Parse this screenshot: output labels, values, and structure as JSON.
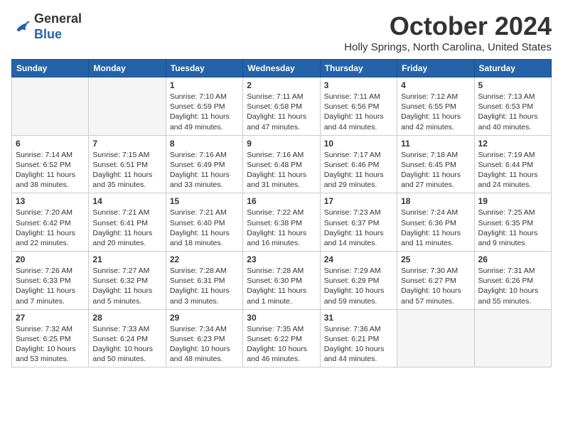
{
  "header": {
    "logo": {
      "general": "General",
      "blue": "Blue"
    },
    "title": "October 2024",
    "location": "Holly Springs, North Carolina, United States"
  },
  "days_of_week": [
    "Sunday",
    "Monday",
    "Tuesday",
    "Wednesday",
    "Thursday",
    "Friday",
    "Saturday"
  ],
  "weeks": [
    [
      {
        "day": "",
        "empty": true
      },
      {
        "day": "",
        "empty": true
      },
      {
        "day": "1",
        "sunrise": "Sunrise: 7:10 AM",
        "sunset": "Sunset: 6:59 PM",
        "daylight": "Daylight: 11 hours and 49 minutes."
      },
      {
        "day": "2",
        "sunrise": "Sunrise: 7:11 AM",
        "sunset": "Sunset: 6:58 PM",
        "daylight": "Daylight: 11 hours and 47 minutes."
      },
      {
        "day": "3",
        "sunrise": "Sunrise: 7:11 AM",
        "sunset": "Sunset: 6:56 PM",
        "daylight": "Daylight: 11 hours and 44 minutes."
      },
      {
        "day": "4",
        "sunrise": "Sunrise: 7:12 AM",
        "sunset": "Sunset: 6:55 PM",
        "daylight": "Daylight: 11 hours and 42 minutes."
      },
      {
        "day": "5",
        "sunrise": "Sunrise: 7:13 AM",
        "sunset": "Sunset: 6:53 PM",
        "daylight": "Daylight: 11 hours and 40 minutes."
      }
    ],
    [
      {
        "day": "6",
        "sunrise": "Sunrise: 7:14 AM",
        "sunset": "Sunset: 6:52 PM",
        "daylight": "Daylight: 11 hours and 38 minutes."
      },
      {
        "day": "7",
        "sunrise": "Sunrise: 7:15 AM",
        "sunset": "Sunset: 6:51 PM",
        "daylight": "Daylight: 11 hours and 35 minutes."
      },
      {
        "day": "8",
        "sunrise": "Sunrise: 7:16 AM",
        "sunset": "Sunset: 6:49 PM",
        "daylight": "Daylight: 11 hours and 33 minutes."
      },
      {
        "day": "9",
        "sunrise": "Sunrise: 7:16 AM",
        "sunset": "Sunset: 6:48 PM",
        "daylight": "Daylight: 11 hours and 31 minutes."
      },
      {
        "day": "10",
        "sunrise": "Sunrise: 7:17 AM",
        "sunset": "Sunset: 6:46 PM",
        "daylight": "Daylight: 11 hours and 29 minutes."
      },
      {
        "day": "11",
        "sunrise": "Sunrise: 7:18 AM",
        "sunset": "Sunset: 6:45 PM",
        "daylight": "Daylight: 11 hours and 27 minutes."
      },
      {
        "day": "12",
        "sunrise": "Sunrise: 7:19 AM",
        "sunset": "Sunset: 6:44 PM",
        "daylight": "Daylight: 11 hours and 24 minutes."
      }
    ],
    [
      {
        "day": "13",
        "sunrise": "Sunrise: 7:20 AM",
        "sunset": "Sunset: 6:42 PM",
        "daylight": "Daylight: 11 hours and 22 minutes."
      },
      {
        "day": "14",
        "sunrise": "Sunrise: 7:21 AM",
        "sunset": "Sunset: 6:41 PM",
        "daylight": "Daylight: 11 hours and 20 minutes."
      },
      {
        "day": "15",
        "sunrise": "Sunrise: 7:21 AM",
        "sunset": "Sunset: 6:40 PM",
        "daylight": "Daylight: 11 hours and 18 minutes."
      },
      {
        "day": "16",
        "sunrise": "Sunrise: 7:22 AM",
        "sunset": "Sunset: 6:38 PM",
        "daylight": "Daylight: 11 hours and 16 minutes."
      },
      {
        "day": "17",
        "sunrise": "Sunrise: 7:23 AM",
        "sunset": "Sunset: 6:37 PM",
        "daylight": "Daylight: 11 hours and 14 minutes."
      },
      {
        "day": "18",
        "sunrise": "Sunrise: 7:24 AM",
        "sunset": "Sunset: 6:36 PM",
        "daylight": "Daylight: 11 hours and 11 minutes."
      },
      {
        "day": "19",
        "sunrise": "Sunrise: 7:25 AM",
        "sunset": "Sunset: 6:35 PM",
        "daylight": "Daylight: 11 hours and 9 minutes."
      }
    ],
    [
      {
        "day": "20",
        "sunrise": "Sunrise: 7:26 AM",
        "sunset": "Sunset: 6:33 PM",
        "daylight": "Daylight: 11 hours and 7 minutes."
      },
      {
        "day": "21",
        "sunrise": "Sunrise: 7:27 AM",
        "sunset": "Sunset: 6:32 PM",
        "daylight": "Daylight: 11 hours and 5 minutes."
      },
      {
        "day": "22",
        "sunrise": "Sunrise: 7:28 AM",
        "sunset": "Sunset: 6:31 PM",
        "daylight": "Daylight: 11 hours and 3 minutes."
      },
      {
        "day": "23",
        "sunrise": "Sunrise: 7:28 AM",
        "sunset": "Sunset: 6:30 PM",
        "daylight": "Daylight: 11 hours and 1 minute."
      },
      {
        "day": "24",
        "sunrise": "Sunrise: 7:29 AM",
        "sunset": "Sunset: 6:29 PM",
        "daylight": "Daylight: 10 hours and 59 minutes."
      },
      {
        "day": "25",
        "sunrise": "Sunrise: 7:30 AM",
        "sunset": "Sunset: 6:27 PM",
        "daylight": "Daylight: 10 hours and 57 minutes."
      },
      {
        "day": "26",
        "sunrise": "Sunrise: 7:31 AM",
        "sunset": "Sunset: 6:26 PM",
        "daylight": "Daylight: 10 hours and 55 minutes."
      }
    ],
    [
      {
        "day": "27",
        "sunrise": "Sunrise: 7:32 AM",
        "sunset": "Sunset: 6:25 PM",
        "daylight": "Daylight: 10 hours and 53 minutes."
      },
      {
        "day": "28",
        "sunrise": "Sunrise: 7:33 AM",
        "sunset": "Sunset: 6:24 PM",
        "daylight": "Daylight: 10 hours and 50 minutes."
      },
      {
        "day": "29",
        "sunrise": "Sunrise: 7:34 AM",
        "sunset": "Sunset: 6:23 PM",
        "daylight": "Daylight: 10 hours and 48 minutes."
      },
      {
        "day": "30",
        "sunrise": "Sunrise: 7:35 AM",
        "sunset": "Sunset: 6:22 PM",
        "daylight": "Daylight: 10 hours and 46 minutes."
      },
      {
        "day": "31",
        "sunrise": "Sunrise: 7:36 AM",
        "sunset": "Sunset: 6:21 PM",
        "daylight": "Daylight: 10 hours and 44 minutes."
      },
      {
        "day": "",
        "empty": true
      },
      {
        "day": "",
        "empty": true
      }
    ]
  ]
}
